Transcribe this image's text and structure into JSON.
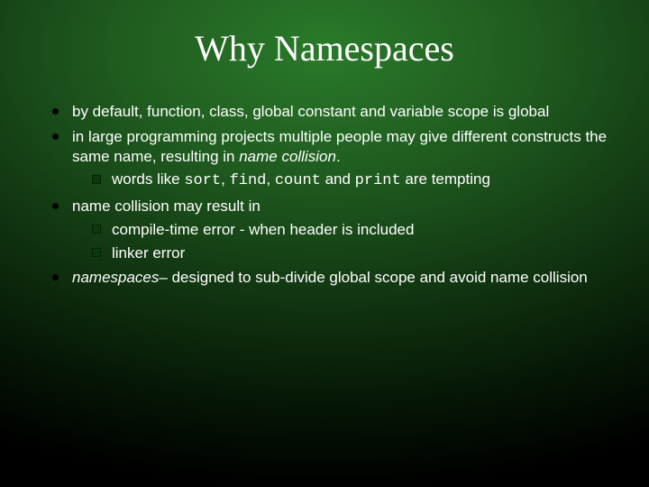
{
  "title": "Why Namespaces",
  "bullets": {
    "b1": "by default, function, class, global constant and variable scope is global",
    "b2a": "in large programming projects multiple people may give different constructs the same name, resulting in ",
    "b2b": "name collision",
    "b2c": ".",
    "b2_sub1a": "words like ",
    "b2_sub1_w1": "sort",
    "b2_sub1_w2": "find",
    "b2_sub1_w3": "count",
    "b2_sub1_w4": "print",
    "b2_sub1_sep": ", ",
    "b2_sub1_and": " and ",
    "b2_sub1b": " are tempting",
    "b3": "name collision may result in",
    "b3_sub1": "compile-time error - when header is included",
    "b3_sub2": "linker error",
    "b4a": "namespaces",
    "b4b": "– designed to sub-divide global scope and avoid name collision"
  }
}
